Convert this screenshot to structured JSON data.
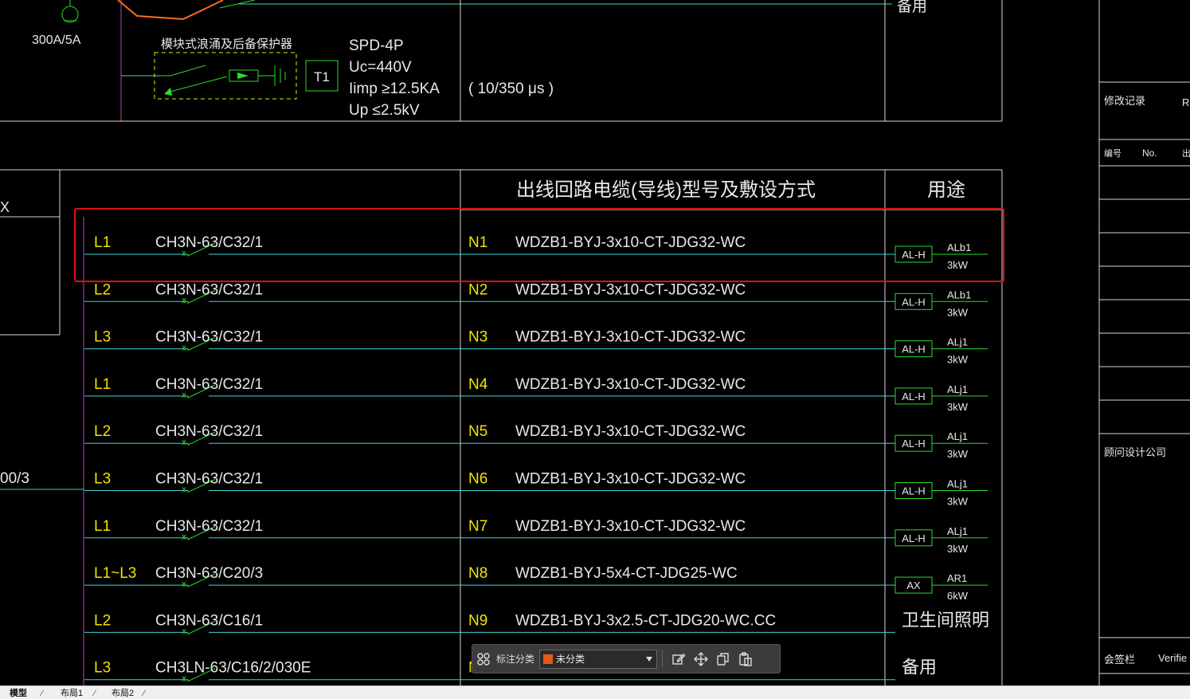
{
  "drawing": {
    "top_section": {
      "meter_label": "300A/5A",
      "spd_device_label": "模块式浪涌及后备保护器",
      "t1_box": "T1",
      "spd_spec_lines": [
        "SPD-4P",
        "Uc=440V",
        "Iimp ≥12.5KA",
        "Up ≤2.5kV"
      ],
      "waveform": "( 10/350   μs )",
      "top_right_label": "备用"
    },
    "left_labels": {
      "partial_x": "X",
      "partial_ratio": "00/3"
    },
    "table_headers": {
      "cable": "出线回路电缆(导线)型号及敷设方式",
      "usage": "用途"
    },
    "circuits": [
      {
        "phase": "L1",
        "breaker": "CH3N-63/C32/1",
        "id": "N1",
        "cable": "WDZB1-BYJ-3x10-CT-JDG32-WC",
        "tag": "AL-H",
        "load": "ALb1",
        "power": "3kW"
      },
      {
        "phase": "L2",
        "breaker": "CH3N-63/C32/1",
        "id": "N2",
        "cable": "WDZB1-BYJ-3x10-CT-JDG32-WC",
        "tag": "AL-H",
        "load": "ALb1",
        "power": "3kW"
      },
      {
        "phase": "L3",
        "breaker": "CH3N-63/C32/1",
        "id": "N3",
        "cable": "WDZB1-BYJ-3x10-CT-JDG32-WC",
        "tag": "AL-H",
        "load": "ALj1",
        "power": "3kW"
      },
      {
        "phase": "L1",
        "breaker": "CH3N-63/C32/1",
        "id": "N4",
        "cable": "WDZB1-BYJ-3x10-CT-JDG32-WC",
        "tag": "AL-H",
        "load": "ALj1",
        "power": "3kW"
      },
      {
        "phase": "L2",
        "breaker": "CH3N-63/C32/1",
        "id": "N5",
        "cable": "WDZB1-BYJ-3x10-CT-JDG32-WC",
        "tag": "AL-H",
        "load": "ALj1",
        "power": "3kW"
      },
      {
        "phase": "L3",
        "breaker": "CH3N-63/C32/1",
        "id": "N6",
        "cable": "WDZB1-BYJ-3x10-CT-JDG32-WC",
        "tag": "AL-H",
        "load": "ALj1",
        "power": "3kW"
      },
      {
        "phase": "L1",
        "breaker": "CH3N-63/C32/1",
        "id": "N7",
        "cable": "WDZB1-BYJ-3x10-CT-JDG32-WC",
        "tag": "AL-H",
        "load": "ALj1",
        "power": "3kW"
      },
      {
        "phase": "L1~L3",
        "breaker": "CH3N-63/C20/3",
        "id": "N8",
        "cable": "WDZB1-BYJ-5x4-CT-JDG25-WC",
        "tag": "AX",
        "load": "AR1",
        "power": "6kW"
      },
      {
        "phase": "L2",
        "breaker": "CH3N-63/C16/1",
        "id": "N9",
        "cable": "WDZB1-BYJ-3x2.5-CT-JDG20-WC.CC",
        "tag": "",
        "load": "卫生间照明",
        "power": ""
      },
      {
        "phase": "L3",
        "breaker": "CH3LN-63/C16/2/030E",
        "id": "N",
        "cable": "",
        "tag": "",
        "load": "备用",
        "power": ""
      }
    ],
    "title_block": {
      "revision": "修改记录",
      "revision_en_partial": "R",
      "number": "编号",
      "number_en": "No.",
      "number_partial": "出",
      "consultant": "顾问设计公司",
      "countersign": "会签栏",
      "verified_partial": "Verifie"
    }
  },
  "toolbar": {
    "label": "标注分类",
    "selected": "未分类",
    "swatch_color": "#e8561c",
    "icons": [
      "grid-icon",
      "edit-icon",
      "move-icon",
      "copy-icon",
      "paste-icon"
    ]
  },
  "tabs": [
    "模型",
    "布局1",
    "布局2"
  ],
  "colors": {
    "highlight_box": "#e01010",
    "text_main": "#e8e8e8",
    "text_phase": "#f0e400",
    "symbol_green": "#2bdc2b",
    "bus_line": "#3fd5d5",
    "bus_magenta": "#c040c0"
  }
}
